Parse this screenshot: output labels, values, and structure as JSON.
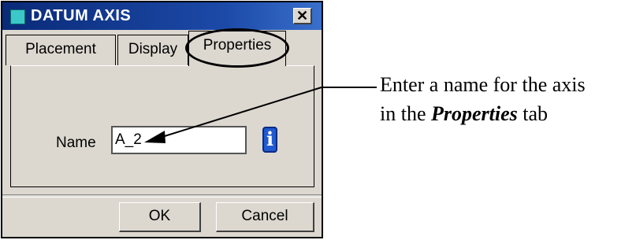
{
  "dialog": {
    "title": "DATUM AXIS",
    "close_glyph": "✕",
    "tabs": [
      {
        "label": "Placement",
        "selected": false
      },
      {
        "label": "Display",
        "selected": false
      },
      {
        "label": "Properties",
        "selected": true
      }
    ],
    "name_label": "Name",
    "name_value": "A_2",
    "info_icon": "info-icon",
    "info_glyph": "i",
    "ok_label": "OK",
    "cancel_label": "Cancel"
  },
  "annotation": {
    "line1": "Enter a name for the axis",
    "line2_prefix": "in the ",
    "line2_emphasis": "Properties",
    "line2_suffix": " tab"
  }
}
